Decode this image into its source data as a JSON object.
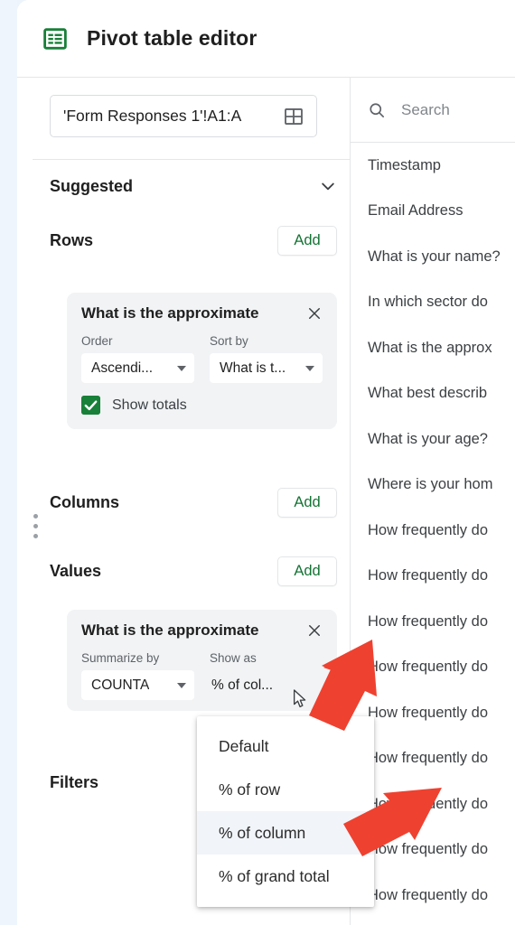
{
  "header": {
    "icon": "sheets-table-icon",
    "title": "Pivot table editor"
  },
  "range": {
    "value": "'Form Responses 1'!A1:A",
    "select_range_icon": "grid-icon"
  },
  "suggested": {
    "label": "Suggested",
    "chevron_icon": "chevron-down-icon"
  },
  "rows": {
    "title": "Rows",
    "add_label": "Add",
    "card": {
      "field_name": "What is the approximate",
      "close_icon": "close-icon",
      "order_label": "Order",
      "order_value": "Ascendi...",
      "sort_by_label": "Sort by",
      "sort_by_value": "What is t...",
      "show_totals_label": "Show totals",
      "show_totals_checked": true
    }
  },
  "columns": {
    "title": "Columns",
    "add_label": "Add"
  },
  "values": {
    "title": "Values",
    "add_label": "Add",
    "card": {
      "field_name": "What is the approximate",
      "close_icon": "close-icon",
      "summarize_by_label": "Summarize by",
      "summarize_by_value": "COUNTA",
      "show_as_label": "Show as",
      "show_as_value": "% of col..."
    }
  },
  "filters": {
    "title": "Filters"
  },
  "show_as_menu": {
    "items": [
      {
        "label": "Default",
        "selected": false
      },
      {
        "label": "% of row",
        "selected": false
      },
      {
        "label": "% of column",
        "selected": true
      },
      {
        "label": "% of grand total",
        "selected": false
      }
    ]
  },
  "field_panel": {
    "search_icon": "search-icon",
    "search_placeholder": "Search",
    "fields": [
      "Timestamp",
      "Email Address",
      "What is your name?",
      "In which sector do",
      "What is the approx",
      "What best describ",
      "What is your age?",
      "Where is your hom",
      "How frequently do",
      "How frequently do",
      "How frequently do",
      "How frequently do",
      "How frequently do",
      "How frequently do",
      "How frequently do",
      "How frequently do",
      "How frequently do"
    ]
  },
  "annotations": {
    "arrow_color": "#ef4130",
    "arrows": [
      {
        "name": "arrow-to-show-as-dropdown"
      },
      {
        "name": "arrow-to-percent-of-column"
      }
    ]
  },
  "colors": {
    "accent_green": "#137333",
    "checkbox_green": "#188038",
    "card_bg": "#f1f3f5",
    "text_primary": "#1f1f1f",
    "text_secondary": "#5f6368"
  }
}
